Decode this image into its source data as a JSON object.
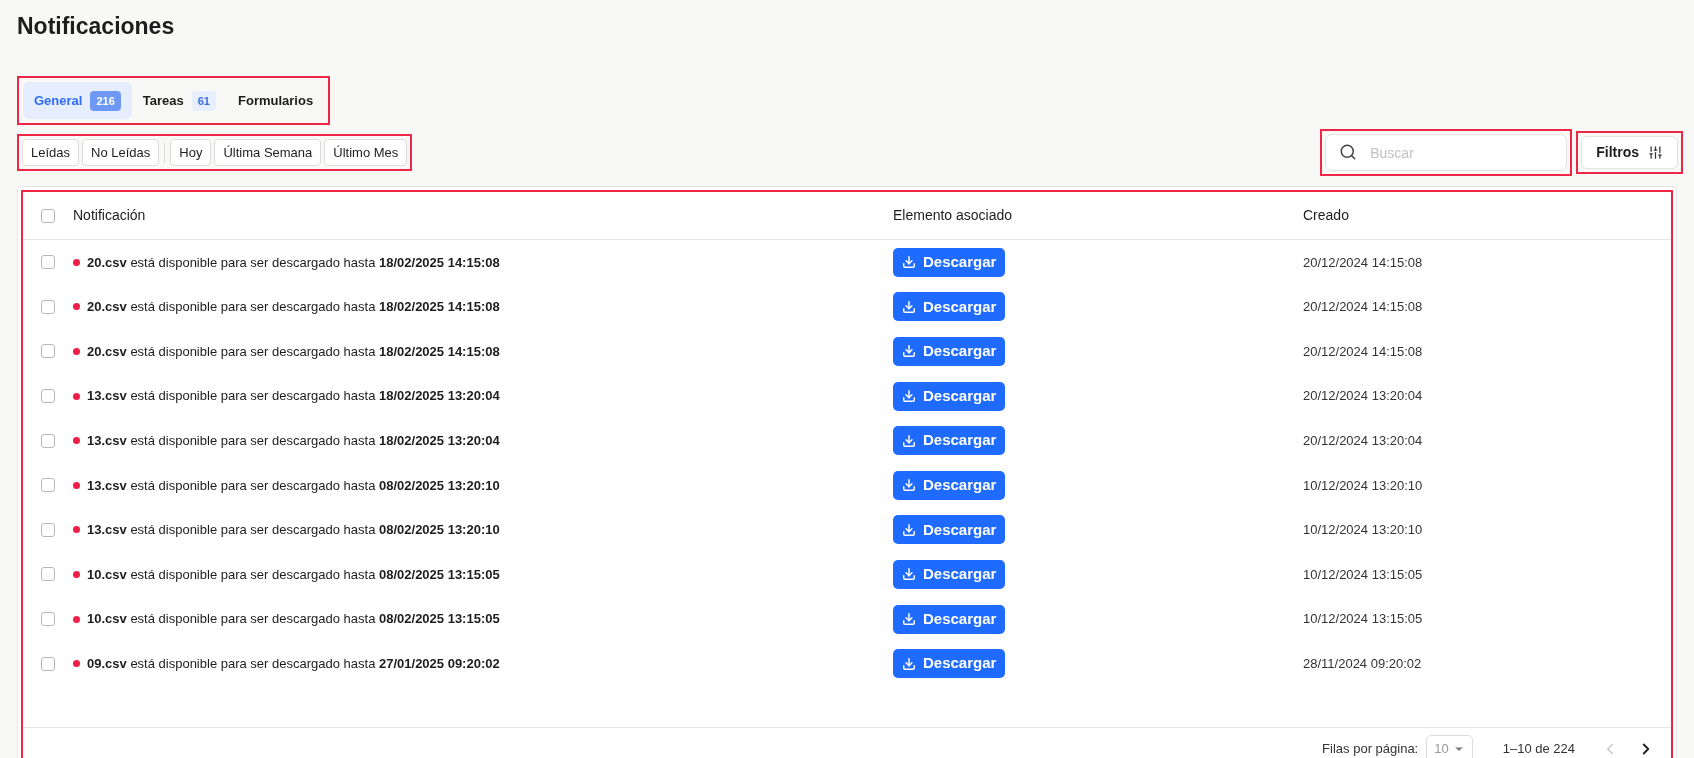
{
  "page": {
    "title": "Notificaciones"
  },
  "tabs": [
    {
      "label": "General",
      "count": "216",
      "selected": true
    },
    {
      "label": "Tareas",
      "count": "61",
      "selected": false
    },
    {
      "label": "Formularios",
      "selected": false
    }
  ],
  "quick_filters": [
    {
      "label": "Leídas",
      "kind": "status"
    },
    {
      "label": "No Leídas",
      "kind": "status"
    },
    {
      "label": "Hoy",
      "kind": "date"
    },
    {
      "label": "Última Semana",
      "kind": "date"
    },
    {
      "label": "Último Mes",
      "kind": "date"
    }
  ],
  "search": {
    "placeholder": "Buscar"
  },
  "filters_button": {
    "label": "Filtros"
  },
  "table": {
    "select_all_checked": false,
    "columns": [
      "Notificación",
      "Elemento asociado",
      "Creado"
    ],
    "rows": [
      {
        "checked": false,
        "unread": true,
        "notification": "**20.csv** está disponible para ser descargado hasta **18/02/2025 14:15:08**",
        "action": "Descargar",
        "created": "20/12/2024 14:15:08"
      },
      {
        "checked": false,
        "unread": true,
        "notification": "**20.csv** está disponible para ser descargado hasta **18/02/2025 14:15:08**",
        "action": "Descargar",
        "created": "20/12/2024 14:15:08"
      },
      {
        "checked": false,
        "unread": true,
        "notification": "**20.csv** está disponible para ser descargado hasta **18/02/2025 14:15:08**",
        "action": "Descargar",
        "created": "20/12/2024 14:15:08"
      },
      {
        "checked": false,
        "unread": true,
        "notification": "**13.csv** está disponible para ser descargado hasta **18/02/2025 13:20:04**",
        "action": "Descargar",
        "created": "20/12/2024 13:20:04"
      },
      {
        "checked": false,
        "unread": true,
        "notification": "**13.csv** está disponible para ser descargado hasta **18/02/2025 13:20:04**",
        "action": "Descargar",
        "created": "20/12/2024 13:20:04"
      },
      {
        "checked": false,
        "unread": true,
        "notification": "**13.csv** está disponible para ser descargado hasta **08/02/2025 13:20:10**",
        "action": "Descargar",
        "created": "10/12/2024 13:20:10"
      },
      {
        "checked": false,
        "unread": true,
        "notification": "**13.csv** está disponible para ser descargado hasta **08/02/2025 13:20:10**",
        "action": "Descargar",
        "created": "10/12/2024 13:20:10"
      },
      {
        "checked": false,
        "unread": true,
        "notification": "**10.csv** está disponible para ser descargado hasta **08/02/2025 13:15:05**",
        "action": "Descargar",
        "created": "10/12/2024 13:15:05"
      },
      {
        "checked": false,
        "unread": true,
        "notification": "**10.csv** está disponible para ser descargado hasta **08/02/2025 13:15:05**",
        "action": "Descargar",
        "created": "10/12/2024 13:15:05"
      },
      {
        "checked": false,
        "unread": true,
        "notification": "**09.csv** está disponible para ser descargado hasta **27/01/2025 09:20:02**",
        "action": "Descargar",
        "created": "28/11/2024 09:20:02"
      }
    ],
    "footer": {
      "rows_per_page_label": "Filas por página:",
      "rows_per_page": "10",
      "range": "1–10 de 224",
      "prev_disabled": true,
      "next_disabled": false
    }
  }
}
